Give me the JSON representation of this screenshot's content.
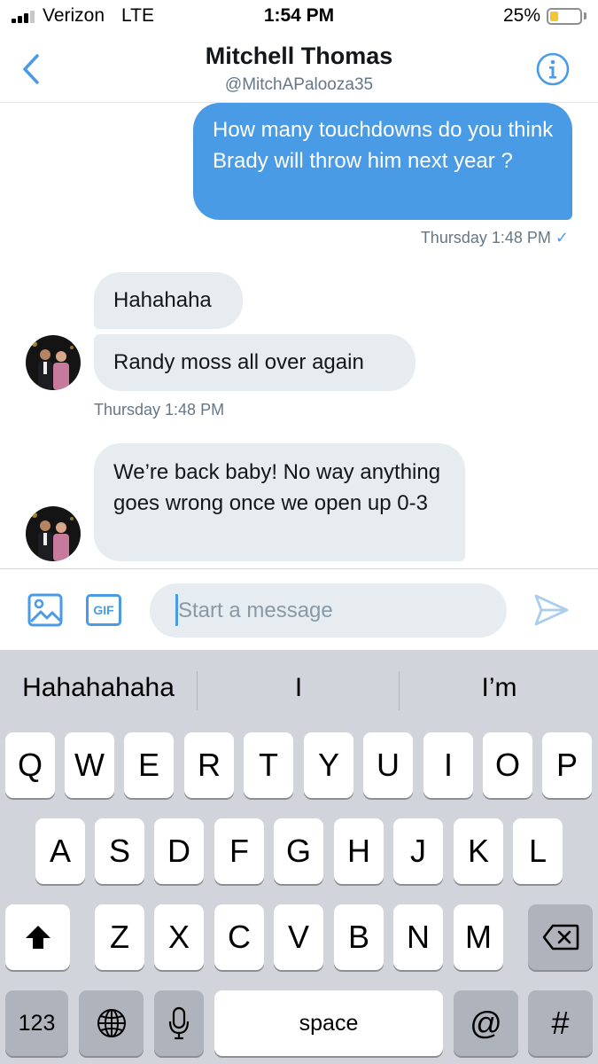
{
  "status_bar": {
    "carrier": "Verizon",
    "network": "LTE",
    "time": "1:54 PM",
    "battery": "25%",
    "battery_level": 0.25,
    "signal_bars": 3
  },
  "header": {
    "name": "Mitchell Thomas",
    "handle": "@MitchAPalooza35",
    "back_icon": "chevron-left-icon",
    "info_icon": "info-icon"
  },
  "messages": {
    "outgoing_1": "How many touchdowns do you think Brady will throw him next year ?",
    "outgoing_1_time": "Thursday 1:48 PM",
    "read_check": "✓",
    "incoming_1": "Hahahaha",
    "incoming_2": "Randy moss all over again",
    "incoming_group_time": "Thursday 1:48 PM",
    "incoming_3": "We’re back baby! No way anything goes wrong once we open up 0-3"
  },
  "composer": {
    "gif_label": "GIF",
    "placeholder": "Start a message",
    "media_icon": "image-icon",
    "send_icon": "send-icon"
  },
  "keyboard": {
    "suggestions": [
      "Hahahahaha",
      "I",
      "I’m"
    ],
    "row1": [
      "Q",
      "W",
      "E",
      "R",
      "T",
      "Y",
      "U",
      "I",
      "O",
      "P"
    ],
    "row2": [
      "A",
      "S",
      "D",
      "F",
      "G",
      "H",
      "J",
      "K",
      "L"
    ],
    "row3": [
      "Z",
      "X",
      "C",
      "V",
      "B",
      "N",
      "M"
    ],
    "numbers_key": "123",
    "space_key": "space",
    "at_key": "@",
    "hash_key": "#"
  },
  "colors": {
    "accent": "#4a9be6",
    "incoming_bubble": "#e6ecf0",
    "keyboard_bg": "#d1d4da",
    "battery_fill": "#f5c431"
  }
}
